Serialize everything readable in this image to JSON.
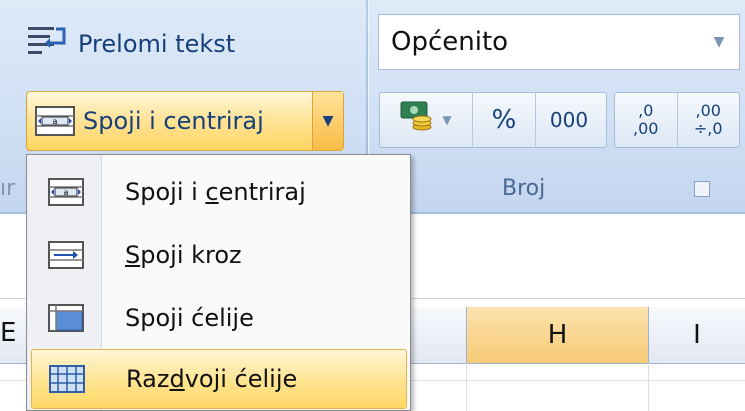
{
  "ribbon": {
    "wrap_text_label": "Prelomi tekst",
    "merge_button_label": "Spoji i centriraj",
    "number_format_value": "Općenito",
    "percent_label": "%",
    "comma_label": "000",
    "increase_decimal_top": ",0",
    "increase_decimal_bottom": ",00",
    "decrease_decimal_top": ",00",
    "decrease_decimal_bottom": "÷,0",
    "number_group_label": "Broj",
    "alignment_group_label_partial": "ır"
  },
  "menu": {
    "items": [
      {
        "pre": "Spoji i ",
        "accel": "c",
        "post": "entriraj",
        "icon": "merge-center-icon"
      },
      {
        "pre": "",
        "accel": "S",
        "post": "poji kroz",
        "icon": "merge-across-icon"
      },
      {
        "pre": "Spoji ćeli",
        "accel": "j",
        "post": "e",
        "icon": "merge-cells-icon"
      },
      {
        "pre": "Raz",
        "accel": "d",
        "post": "voji ćelije",
        "icon": "unmerge-cells-icon",
        "highlighted": true
      }
    ]
  },
  "sheet": {
    "partial_col_left": "E",
    "col_H": "H",
    "col_I": "I"
  },
  "colors": {
    "ribbon_bg": "#d0e0f5",
    "accent_text": "#16407a",
    "highlight": "#ffe38f",
    "selected_header": "#f8cb75"
  }
}
